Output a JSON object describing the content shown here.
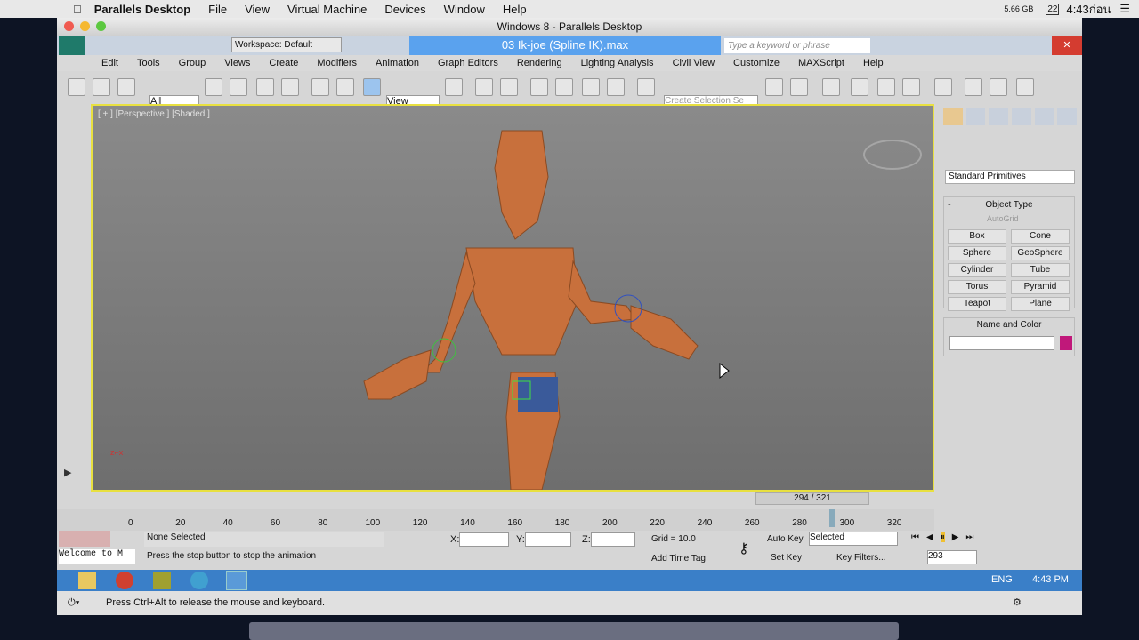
{
  "mac_menu": {
    "app": "Parallels Desktop",
    "items": [
      "File",
      "View",
      "Virtual Machine",
      "Devices",
      "Window",
      "Help"
    ],
    "memory": "5.66 GB",
    "date": "22",
    "time": "4:43ก่อน"
  },
  "window": {
    "title": "Windows 8 - Parallels Desktop"
  },
  "max": {
    "workspace": "Workspace: Default",
    "file_name": "03 Ik-joe (Spline IK).max",
    "search_placeholder": "Type a keyword or phrase",
    "menu": [
      "Edit",
      "Tools",
      "Group",
      "Views",
      "Create",
      "Modifiers",
      "Animation",
      "Graph Editors",
      "Rendering",
      "Lighting Analysis",
      "Civil View",
      "Customize",
      "MAXScript",
      "Help"
    ],
    "filter": "All",
    "ref_coord": "View",
    "selection_set_placeholder": "Create Selection Se"
  },
  "viewport": {
    "label": "[ + ] [Perspective ] [Shaded ]"
  },
  "command_panel": {
    "dropdown": "Standard Primitives",
    "object_type_title": "Object Type",
    "autogrid": "AutoGrid",
    "buttons": [
      "Box",
      "Cone",
      "Sphere",
      "GeoSphere",
      "Cylinder",
      "Tube",
      "Torus",
      "Pyramid",
      "Teapot",
      "Plane"
    ],
    "name_color_title": "Name and Color",
    "name_value": "",
    "object_color": "#c0187a",
    "collapse": "-"
  },
  "timeline": {
    "frame": "294 / 321",
    "current": 294,
    "total": 321,
    "ticks": [
      "0",
      "20",
      "40",
      "60",
      "80",
      "100",
      "120",
      "140",
      "160",
      "180",
      "200",
      "220",
      "240",
      "260",
      "280",
      "300",
      "320"
    ]
  },
  "status": {
    "selection": "None Selected",
    "prompt": "Press the stop button to stop the animation",
    "x_label": "X:",
    "y_label": "Y:",
    "z_label": "Z:",
    "grid": "Grid = 10.0",
    "add_time_tag": "Add Time Tag",
    "auto_key": "Auto Key",
    "set_key": "Set Key",
    "key_mode": "Selected",
    "key_filters": "Key Filters...",
    "frame_field": "293",
    "listener": "Welcome to M"
  },
  "taskbar": {
    "lang": "ENG",
    "time": "4:43 PM"
  },
  "parallels_bar": {
    "message": "Press Ctrl+Alt to release the mouse and keyboard."
  }
}
